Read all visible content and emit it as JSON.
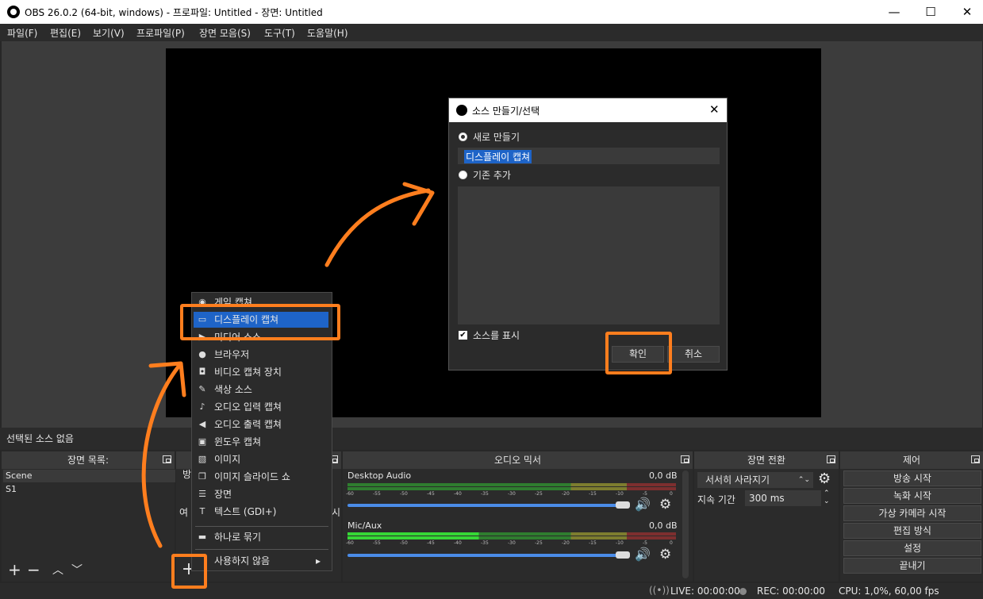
{
  "window": {
    "title": "OBS 26.0.2 (64-bit, windows) - 프로파일: Untitled - 장면: Untitled",
    "minimize": "—",
    "maximize": "☐",
    "close": "✕"
  },
  "menu": [
    "파일(F)",
    "편집(E)",
    "보기(V)",
    "프로파일(P)",
    "장면 모음(S)",
    "도구(T)",
    "도움말(H)"
  ],
  "sources_bar": {
    "text": "선택된 소스 없음"
  },
  "scenes": {
    "header": "장면 목록:",
    "items": [
      "Scene",
      "S1"
    ]
  },
  "sources": {
    "peek_top": "방",
    "peek_mid": "여",
    "peek_right": "시"
  },
  "mixer": {
    "header": "오디오 믹서",
    "ticks": [
      "-60",
      "-55",
      "-50",
      "-45",
      "-40",
      "-35",
      "-30",
      "-25",
      "-20",
      "-15",
      "-10",
      "-5",
      "0"
    ],
    "channels": [
      {
        "name": "Desktop Audio",
        "db": "0,0 dB",
        "lit": false
      },
      {
        "name": "Mic/Aux",
        "db": "0,0 dB",
        "lit": true
      }
    ]
  },
  "transitions": {
    "header": "장면 전환",
    "selected": "서서히 사라지기",
    "duration_label": "지속 기간",
    "duration_value": "300 ms"
  },
  "controls": {
    "header": "제어",
    "buttons": [
      "방송 시작",
      "녹화 시작",
      "가상 카메라 시작",
      "편집 방식",
      "설정",
      "끝내기"
    ]
  },
  "status": {
    "live": "LIVE: 00:00:00",
    "rec": "REC: 00:00:00",
    "cpu": "CPU: 1,0%, 60,00 fps"
  },
  "context_menu": {
    "items": [
      {
        "label": "게임 캡쳐",
        "icon": "gamepad-icon"
      },
      {
        "label": "디스플레이 캡쳐",
        "icon": "monitor-icon",
        "selected": true
      },
      {
        "label": "미디어 소스",
        "icon": "play-icon"
      },
      {
        "label": "브라우저",
        "icon": "globe-icon"
      },
      {
        "label": "비디오 캡쳐 장치",
        "icon": "camera-icon"
      },
      {
        "label": "색상 소스",
        "icon": "brush-icon"
      },
      {
        "label": "오디오 입력 캡쳐",
        "icon": "microphone-icon"
      },
      {
        "label": "오디오 출력 캡쳐",
        "icon": "speaker-icon"
      },
      {
        "label": "윈도우 캡쳐",
        "icon": "window-icon"
      },
      {
        "label": "이미지",
        "icon": "image-icon"
      },
      {
        "label": "이미지 슬라이드 쇼",
        "icon": "slideshow-icon"
      },
      {
        "label": "장면",
        "icon": "list-icon"
      },
      {
        "label": "텍스트 (GDI+)",
        "icon": "text-icon"
      }
    ],
    "group": {
      "label": "하나로 묶기",
      "icon": "folder-icon"
    },
    "deprecated": {
      "label": "사용하지 않음",
      "icon": "chevron-right-icon"
    }
  },
  "dialog": {
    "title": "소스 만들기/선택",
    "create_new": "새로 만들기",
    "name_value": "디스플레이 캡쳐",
    "add_existing": "기존 추가",
    "visible_label": "소스를 표시",
    "ok": "확인",
    "cancel": "취소"
  },
  "colors": {
    "accent": "#ff7e1e",
    "selection": "#1e64c8",
    "background": "#272727"
  }
}
